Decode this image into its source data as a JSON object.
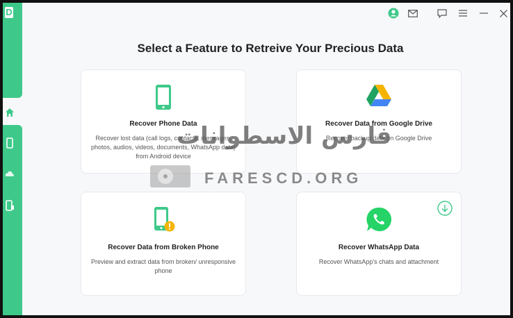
{
  "app": {
    "logo_letter": "D"
  },
  "heading": "Select a Feature to Retreive Your Precious Data",
  "cards": [
    {
      "title": "Recover Phone Data",
      "description": "Recover lost data (call logs, contacts, messages, photos, audios, videos, documents, WhatsApp data) from Android device",
      "icon": "phone-icon"
    },
    {
      "title": "Recover Data from Google Drive",
      "description": "Recover backup data on Google Drive",
      "icon": "google-drive-icon"
    },
    {
      "title": "Recover Data from Broken Phone",
      "description": "Preview and extract data from broken/ unresponsive phone",
      "icon": "broken-phone-icon"
    },
    {
      "title": "Recover WhatsApp Data",
      "description": "Recover WhatsApp's chats and attachment",
      "icon": "whatsapp-icon"
    }
  ],
  "watermark": {
    "arabic": "فارس الاسطوانات",
    "latin": "FARESCD.ORG"
  },
  "colors": {
    "accent": "#3ec98a",
    "warning": "#f5b400",
    "whatsapp": "#25d366"
  }
}
